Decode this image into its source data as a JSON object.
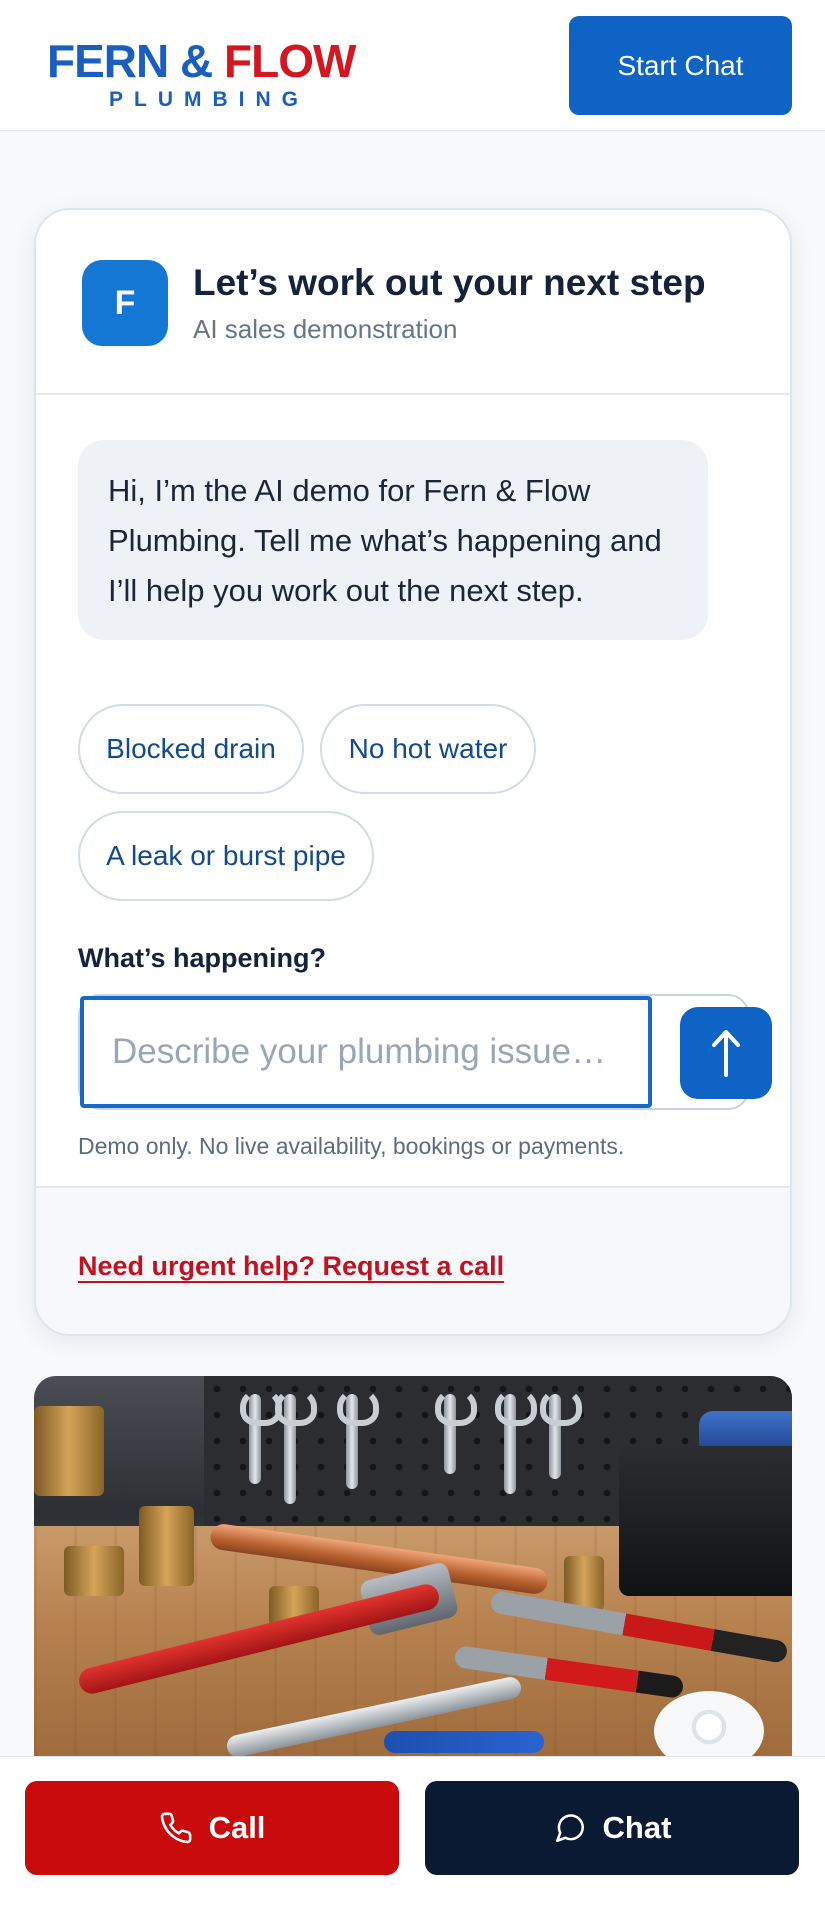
{
  "header": {
    "logo": {
      "part1": "FERN",
      "amp": "&",
      "part2": "FLOW",
      "sub": "PLUMBING"
    },
    "start_chat_label": "Start Chat"
  },
  "chat_card": {
    "avatar_letter": "F",
    "title": "Let’s work out your next step",
    "subtitle": "AI sales demonstration",
    "bot_message": "Hi, I’m the AI demo for Fern & Flow Plumbing. Tell me what’s happening and I’ll help you work out the next step.",
    "quick_replies": [
      "Blocked drain",
      "No hot water",
      "A leak or burst pipe"
    ],
    "input_label": "What’s happening?",
    "input_placeholder": "Describe your plumbing issue…",
    "input_value": "",
    "disclaimer": "Demo only. No live availability, bookings or payments.",
    "urgent_link": "Need urgent help? Request a call"
  },
  "bottom_bar": {
    "call_label": "Call",
    "chat_label": "Chat"
  },
  "colors": {
    "brand_blue": "#0e63c4",
    "brand_red": "#c80a0a",
    "navy": "#0b1a33",
    "link_red": "#c1121f"
  },
  "icons": {
    "send": "arrow-up-icon",
    "call": "phone-icon",
    "chat": "chat-bubble-icon"
  }
}
